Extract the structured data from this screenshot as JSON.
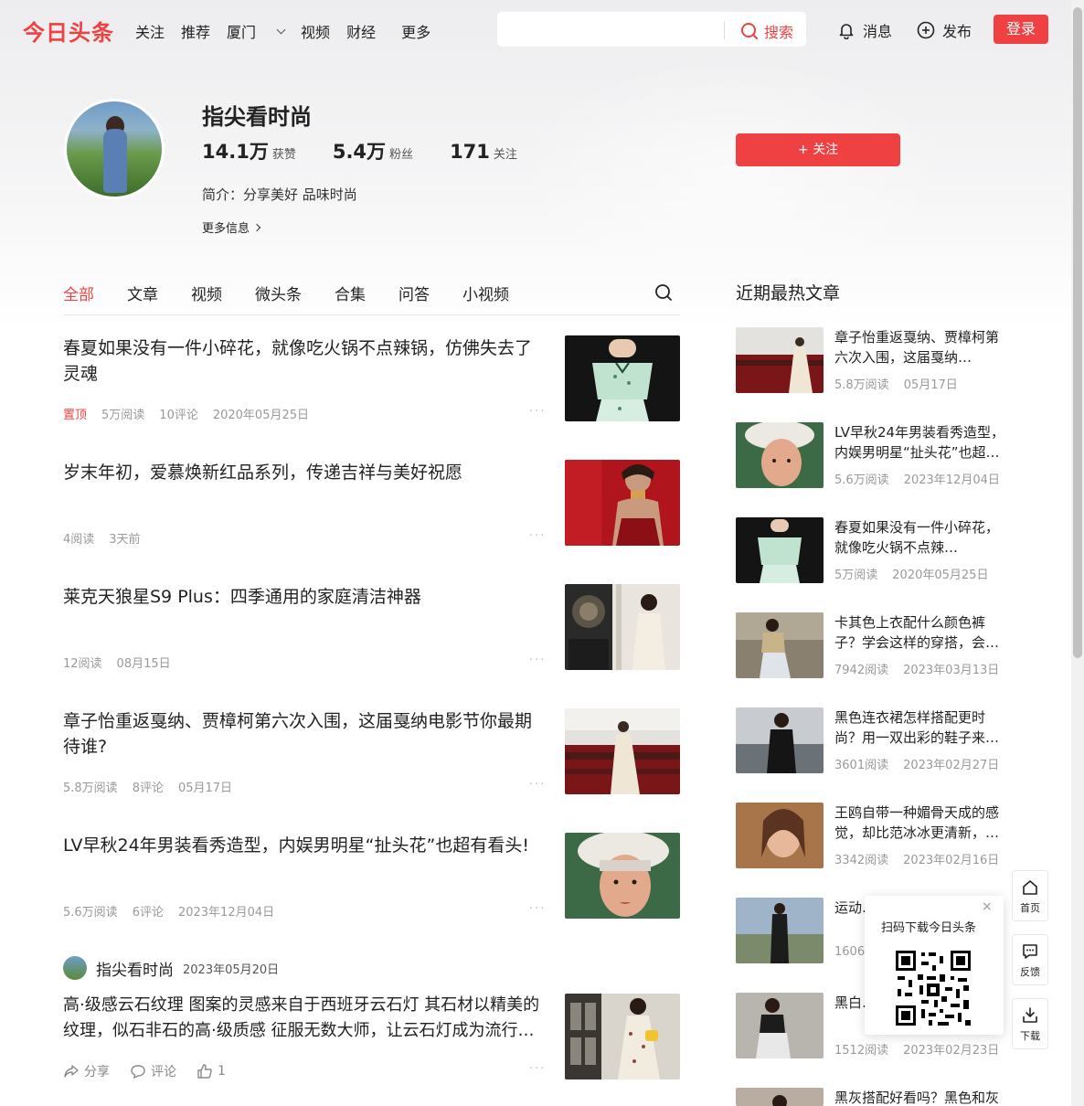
{
  "header": {
    "logo": "今日头条",
    "nav": [
      "关注",
      "推荐",
      "厦门",
      "视频",
      "财经",
      "更多"
    ],
    "search_placeholder": "",
    "search_button": "搜索",
    "messages": "消息",
    "publish": "发布",
    "login": "登录"
  },
  "profile": {
    "name": "指尖看时尚",
    "likes_num": "14.1万",
    "likes_label": "获赞",
    "fans_num": "5.4万",
    "fans_label": "粉丝",
    "following_num": "171",
    "following_label": "关注",
    "bio": "简介：分享美好 品味时尚",
    "more_info": "更多信息",
    "follow_button": "+ 关注"
  },
  "tabs": [
    "全部",
    "文章",
    "视频",
    "微头条",
    "合集",
    "问答",
    "小视频"
  ],
  "feed": [
    {
      "title": "春夏如果没有一件小碎花，就像吃火锅不点辣锅，仿佛失去了灵魂",
      "pinned": "置顶",
      "reads": "5万阅读",
      "comments": "10评论",
      "date": "2020年05月25日"
    },
    {
      "title": "岁末年初，爱慕焕新红品系列，传递吉祥与美好祝愿",
      "pinned": "",
      "reads": "4阅读",
      "comments": "",
      "date": "3天前"
    },
    {
      "title": "莱克天狼星S9 Plus：四季通用的家庭清洁神器",
      "pinned": "",
      "reads": "12阅读",
      "comments": "",
      "date": "08月15日"
    },
    {
      "title": "章子怡重返戛纳、贾樟柯第六次入围，这届戛纳电影节你最期待谁?",
      "pinned": "",
      "reads": "5.8万阅读",
      "comments": "8评论",
      "date": "05月17日"
    },
    {
      "title": "LV早秋24年男装看秀造型，内娱男明星“扯头花”也超有看头!",
      "pinned": "",
      "reads": "5.6万阅读",
      "comments": "6评论",
      "date": "2023年12月04日"
    }
  ],
  "post": {
    "author": "指尖看时尚",
    "date": "2023年05月20日",
    "body": "高·级感云石纹理 图案的灵感来自于西班牙云石灯 其石材以精美的纹理，似石非石的高·级质感 征服无数大师，让云石灯成为流行…",
    "share": "分享",
    "comment": "评论",
    "likes": "1"
  },
  "sidebar": {
    "title": "近期最热文章",
    "items": [
      {
        "title": "章子怡重返戛纳、贾樟柯第六次入围，这届戛纳…",
        "reads": "5.8万阅读",
        "date": "05月17日"
      },
      {
        "title": "LV早秋24年男装看秀造型，内娱男明星“扯头花”也超…",
        "reads": "5.6万阅读",
        "date": "2023年12月04日"
      },
      {
        "title": "春夏如果没有一件小碎花，就像吃火锅不点辣…",
        "reads": "5万阅读",
        "date": "2020年05月25日"
      },
      {
        "title": "卡其色上衣配什么颜色裤子？学会这样的穿搭，会…",
        "reads": "7942阅读",
        "date": "2023年03月13日"
      },
      {
        "title": "黑色连衣裙怎样搭配更时尚？用一双出彩的鞋子来…",
        "reads": "3601阅读",
        "date": "2023年02月27日"
      },
      {
        "title": "王鸥自带一种媚骨天成的感觉，却比范冰冰更清新，…",
        "reads": "3342阅读",
        "date": "2023年02月16日"
      },
      {
        "title": "运动…的运…",
        "reads": "1606…",
        "date": ""
      },
      {
        "title": "黑白…纯色…",
        "reads": "1512阅读",
        "date": "2023年02月23日"
      },
      {
        "title": "黑灰搭配好看吗？黑色和灰",
        "reads": "",
        "date": ""
      }
    ]
  },
  "qr_popup": {
    "text": "扫码下载今日头条",
    "close": "×"
  },
  "float_bar": {
    "home": "首页",
    "feedback": "反馈",
    "download": "下载"
  },
  "colors": {
    "accent": "#f04142",
    "meta": "#999999"
  }
}
